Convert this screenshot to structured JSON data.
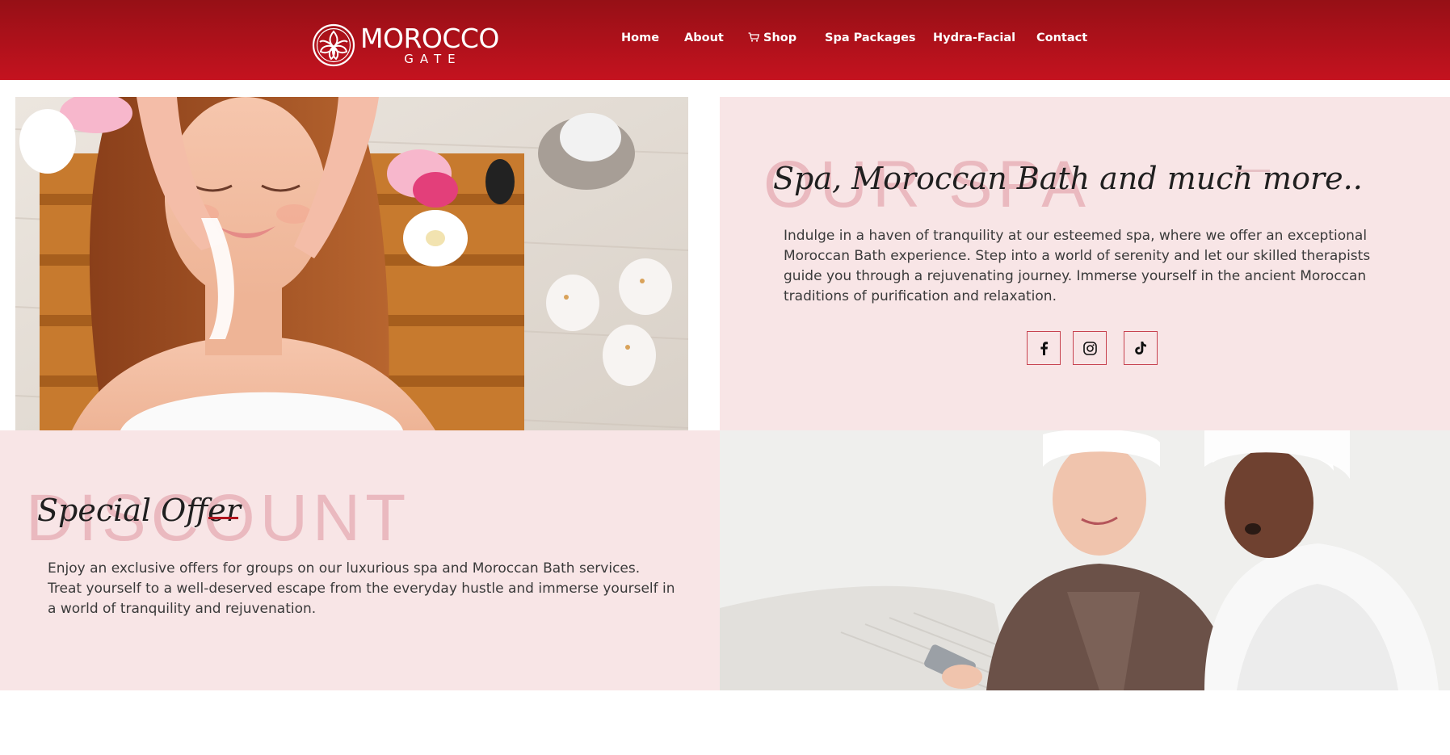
{
  "brand": {
    "name": "MOROCCO",
    "tagline": "GATE"
  },
  "nav": {
    "items": [
      {
        "label": "Home"
      },
      {
        "label": "About"
      },
      {
        "label": "Shop",
        "icon": "cart-icon"
      },
      {
        "label": "Spa Packages"
      },
      {
        "label": "Hydra-Facial"
      },
      {
        "label": "Contact"
      }
    ]
  },
  "spa_section": {
    "ghost_text": "OUR SPA",
    "title": "Spa, Moroccan Bath and much more..",
    "body": "Indulge in a haven of tranquility at our esteemed spa, where we offer an exceptional Moroccan Bath experience. Step into a world of serenity and let our skilled therapists guide you through a rejuvenating journey. Immerse yourself in the ancient Moroccan traditions of purification and relaxation.",
    "social": [
      "facebook-icon",
      "instagram-icon",
      "tiktok-icon"
    ]
  },
  "offer_section": {
    "ghost_text": "DISCOUNT",
    "title": "Special Offer",
    "body": "Enjoy an exclusive offers for groups on our luxurious spa and Moroccan Bath services. Treat yourself to a well-deserved escape from the everyday hustle and immerse yourself in a world of tranquility and rejuvenation."
  },
  "colors": {
    "header_top": "#961016",
    "header_bottom": "#c4121f",
    "panel_bg": "#f8e5e6",
    "ghost_text": "#eab9bf",
    "accent_dash": "#b0141e",
    "icon_border": "#c7424f"
  }
}
